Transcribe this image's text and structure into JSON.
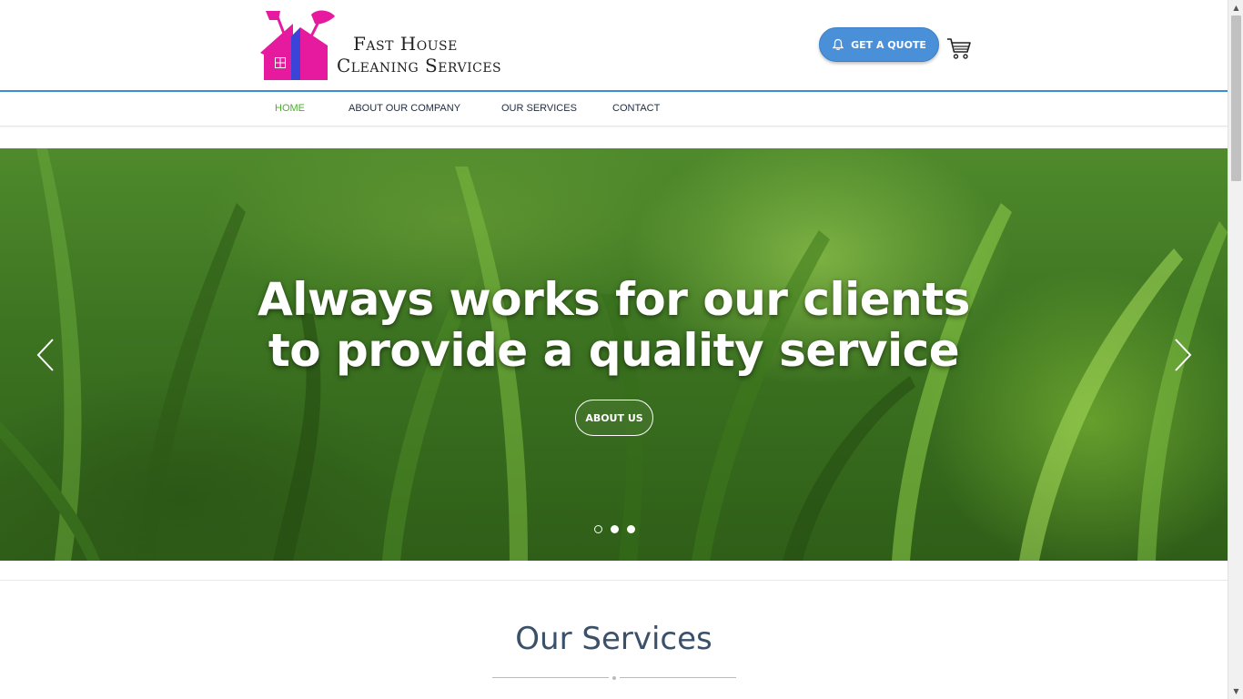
{
  "brand": {
    "line1": "Fast House",
    "line2": "Cleaning Services",
    "colors": {
      "pink": "#e61a9e",
      "blue": "#3b44d6"
    }
  },
  "header": {
    "quote_button": "GET A QUOTE",
    "cart_icon": "cart-icon",
    "accent": "#3d8fd4"
  },
  "nav": {
    "items": [
      {
        "label": "HOME",
        "active": true
      },
      {
        "label": "ABOUT OUR COMPANY",
        "active": false
      },
      {
        "label": "OUR SERVICES",
        "active": false
      },
      {
        "label": "CONTACT",
        "active": false
      }
    ],
    "active_color": "#4cae2e"
  },
  "hero": {
    "title_line1": "Always works for our clients",
    "title_line2": "to provide a quality service",
    "button": "ABOUT US",
    "slides": 3,
    "active_slide": 1
  },
  "services": {
    "title": "Our Services"
  }
}
